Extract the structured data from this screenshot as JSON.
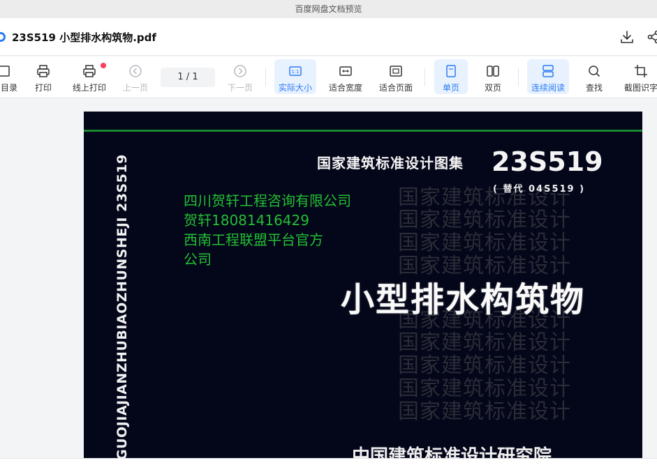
{
  "window": {
    "title": "百度网盘文档预览"
  },
  "header": {
    "file_title": "23S519 小型排水构筑物.pdf",
    "download_icon": "download-icon",
    "share_icon": "share-icon"
  },
  "toolbar": {
    "catalog": "目录",
    "print": "打印",
    "online_print": "线上打印",
    "prev": "上一页",
    "page_indicator": "1  / 1",
    "next": "下一页",
    "actual_size": "实际大小",
    "fit_width": "适合宽度",
    "fit_page": "适合页面",
    "single": "单页",
    "double": "双页",
    "continuous": "连续阅读",
    "find": "查找",
    "ocr": "截图识字"
  },
  "document": {
    "spine_text": "GUOJIAJIANZHUBIAOZHUNSHEJI 23S519",
    "atlas_title": "国家建筑标准设计图集",
    "atlas_code": "23S519",
    "replace_note": "( 替代 04S519 )",
    "watermark_line": "国家建筑标准设计",
    "main_title": "小型排水构筑物",
    "institute": "中国建筑标准设计研究院",
    "overlay_lines": [
      "四川贺轩工程咨询有限公司",
      "贺轩18081416429",
      "西南工程联盟平台官方",
      "公司"
    ]
  },
  "colors": {
    "accent": "#2b7cf6",
    "overlay_green": "#23c033",
    "cover_bg": "#04061a",
    "stripe": "#1a8a2e"
  }
}
